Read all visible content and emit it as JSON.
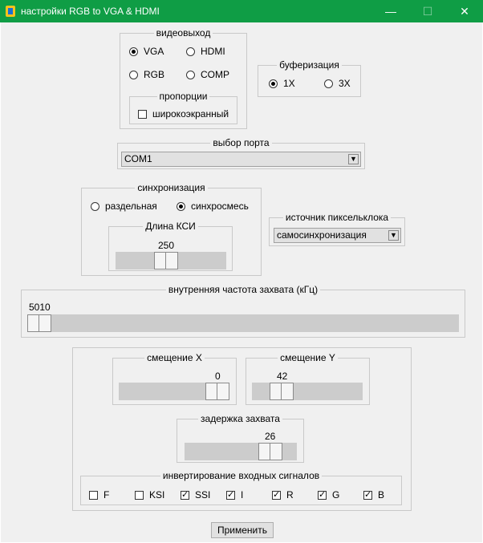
{
  "window": {
    "title": "настройки RGB to VGA & HDMI",
    "minimize": "—",
    "maximize": "☐",
    "close": "✕"
  },
  "video_output": {
    "legend": "видеовыход",
    "options": [
      {
        "label": "VGA",
        "selected": true
      },
      {
        "label": "HDMI",
        "selected": false
      },
      {
        "label": "RGB",
        "selected": false
      },
      {
        "label": "COMP",
        "selected": false
      }
    ],
    "proportions": {
      "legend": "пропорции",
      "widescreen": {
        "label": "широкоэкранный",
        "checked": false
      }
    }
  },
  "buffering": {
    "legend": "буферизация",
    "options": [
      {
        "label": "1X",
        "selected": true
      },
      {
        "label": "3X",
        "selected": false
      }
    ]
  },
  "port": {
    "legend": "выбор порта",
    "value": "COM1"
  },
  "sync": {
    "legend": "синхронизация",
    "options": [
      {
        "label": "раздельная",
        "selected": false
      },
      {
        "label": "синхросмесь",
        "selected": true
      }
    ],
    "ksi": {
      "legend": "Длина КСИ",
      "value": "250"
    }
  },
  "pixel_clock": {
    "legend": "источник пиксельклока",
    "value": "самосинхронизация"
  },
  "capture_freq": {
    "legend": "внутренняя частота захвата (кГц)",
    "value": "5010"
  },
  "offsets": {
    "x": {
      "legend": "смещение X",
      "value": "0"
    },
    "y": {
      "legend": "смещение Y",
      "value": "42"
    },
    "delay": {
      "legend": "задержка захвата",
      "value": "26"
    }
  },
  "invert": {
    "legend": "инвертирование входных сигналов",
    "signals": [
      {
        "label": "F",
        "checked": false
      },
      {
        "label": "KSI",
        "checked": false
      },
      {
        "label": "SSI",
        "checked": true
      },
      {
        "label": "I",
        "checked": true
      },
      {
        "label": "R",
        "checked": true
      },
      {
        "label": "G",
        "checked": true
      },
      {
        "label": "B",
        "checked": true
      }
    ]
  },
  "apply_label": "Применить"
}
